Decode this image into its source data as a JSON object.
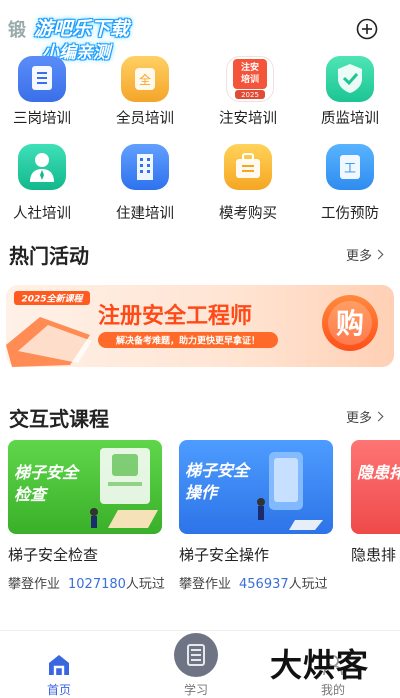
{
  "top_bar": {
    "watermark_dim": "锻",
    "watermark_top": "游吧乐下载",
    "watermark_bottom": "小编亲测",
    "add_icon": "plus-circle-icon"
  },
  "grid": {
    "rows": [
      [
        {
          "label": "三岗培训",
          "icon": "document-icon",
          "color": "#ffffff"
        },
        {
          "label": "全员培训",
          "icon": "all-badge-icon",
          "color": "#f7b53a"
        },
        {
          "label": "注安培训",
          "icon": "book-2025-icon",
          "color": "#ffffff",
          "tag1": "注安",
          "tag2": "培训",
          "year": "2025"
        },
        {
          "label": "质监培训",
          "icon": "shield-check-icon",
          "color": "#2ed3a3"
        }
      ],
      [
        {
          "label": "人社培训",
          "icon": "person-icon",
          "color": "#27c9a2"
        },
        {
          "label": "住建培训",
          "icon": "building-icon",
          "color": "#3b82f6"
        },
        {
          "label": "模考购买",
          "icon": "briefcase-icon",
          "color": "#f7c23a"
        },
        {
          "label": "工伤预防",
          "icon": "work-injury-icon",
          "color": "#3b9cf6"
        }
      ]
    ]
  },
  "hot": {
    "title": "热门活动",
    "more": "更多",
    "banner": {
      "tag": "2025全新课程",
      "headline": "注册安全工程师",
      "sub": "解决备考难题，助力更快更早拿证！",
      "cta": "购"
    }
  },
  "courses": {
    "title": "交互式课程",
    "more": "更多",
    "items": [
      {
        "title": "梯子安全检查",
        "image_text_1": "梯子安全",
        "image_text_2": "检查",
        "category": "攀登作业",
        "count": "1027180",
        "suffix": "人玩过",
        "color": "#4cc23a"
      },
      {
        "title": "梯子安全操作",
        "image_text_1": "梯子安全",
        "image_text_2": "操作",
        "category": "攀登作业",
        "count": "456937",
        "suffix": "人玩过",
        "color": "#3a8cf0"
      },
      {
        "title": "隐患排",
        "image_text_1": "隐患排",
        "image_text_2": "",
        "category": "",
        "count": "",
        "suffix": "",
        "color": "#f25a5a"
      }
    ]
  },
  "nav": {
    "items": [
      {
        "label": "首页",
        "icon": "home-icon",
        "active": true
      },
      {
        "label": "学习",
        "icon": "study-icon",
        "active": false
      },
      {
        "label": "我的",
        "icon": "profile-icon",
        "active": false
      }
    ],
    "brand": "大烘客"
  }
}
